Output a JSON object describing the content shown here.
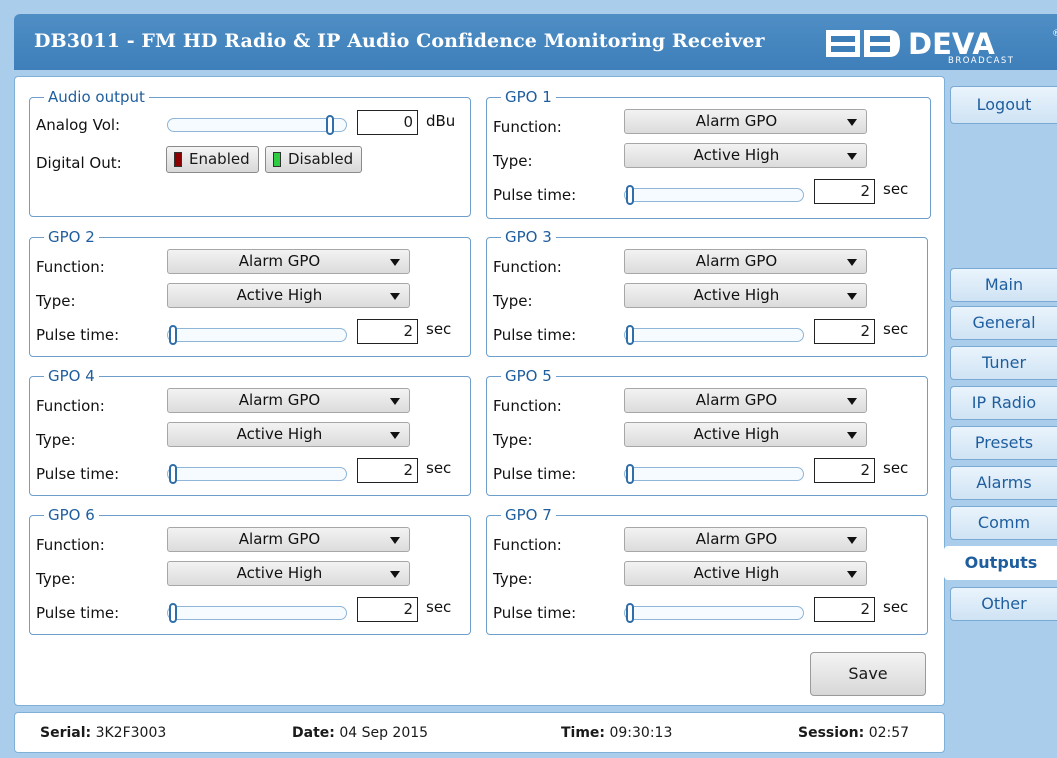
{
  "header": {
    "title": "DB3011 - FM HD Radio & IP Audio Confidence Monitoring Receiver",
    "logo_text": "DEVA",
    "logo_sub": "BROADCAST",
    "logo_mark": "DB"
  },
  "audio_output": {
    "legend": "Audio output",
    "analog_label": "Analog Vol:",
    "analog_value": "0",
    "analog_unit": "dBu",
    "digital_label": "Digital Out:",
    "enabled_label": "Enabled",
    "disabled_label": "Disabled"
  },
  "labels": {
    "function": "Function:",
    "type": "Type:",
    "pulse": "Pulse time:",
    "sec": "sec"
  },
  "gpos": [
    {
      "legend": "GPO 1",
      "function": "Alarm GPO",
      "type": "Active High",
      "pulse": "2"
    },
    {
      "legend": "GPO 2",
      "function": "Alarm GPO",
      "type": "Active High",
      "pulse": "2"
    },
    {
      "legend": "GPO 3",
      "function": "Alarm GPO",
      "type": "Active High",
      "pulse": "2"
    },
    {
      "legend": "GPO 4",
      "function": "Alarm GPO",
      "type": "Active High",
      "pulse": "2"
    },
    {
      "legend": "GPO 5",
      "function": "Alarm GPO",
      "type": "Active High",
      "pulse": "2"
    },
    {
      "legend": "GPO 6",
      "function": "Alarm GPO",
      "type": "Active High",
      "pulse": "2"
    },
    {
      "legend": "GPO 7",
      "function": "Alarm GPO",
      "type": "Active High",
      "pulse": "2"
    }
  ],
  "save_label": "Save",
  "footer": {
    "serial_label": "Serial:",
    "serial": "3K2F3003",
    "date_label": "Date:",
    "date": "04 Sep 2015",
    "time_label": "Time:",
    "time": "09:30:13",
    "session_label": "Session:",
    "session": "02:57"
  },
  "nav": {
    "logout": "Logout",
    "tabs": [
      "Main",
      "General",
      "Tuner",
      "IP Radio",
      "Presets",
      "Alarms",
      "Comm",
      "Outputs",
      "Other"
    ],
    "active": "Outputs"
  },
  "colors": {
    "accent": "#3e7fba",
    "frame": "#a9cdea",
    "led_enabled": "#8b0000",
    "led_disabled": "#2ecc40"
  }
}
